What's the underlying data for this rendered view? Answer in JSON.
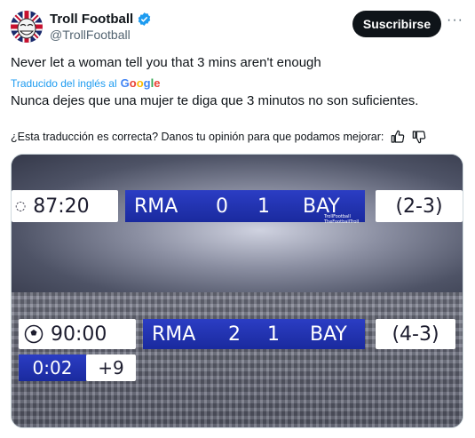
{
  "header": {
    "display_name": "Troll Football",
    "handle": "@TrollFootball",
    "subscribe_label": "Suscribirse",
    "more_label": "···"
  },
  "tweet": {
    "text": "Never let a woman tell you that 3 mins aren't enough",
    "translated_from": "Traducido del inglés al",
    "google_label": "Google",
    "translation": "Nunca dejes que una mujer te diga que 3 minutos no son suficientes.",
    "feedback": "¿Esta traducción es correcta? Danos tu opinión para que podamos mejorar:"
  },
  "media": {
    "top": {
      "time": "87:20",
      "home": "RMA",
      "home_score": "0",
      "away_score": "1",
      "away": "BAY",
      "aggregate": "(2-3)",
      "logo1": "TrollFootball",
      "logo2": "TheFootballTroll"
    },
    "bottom": {
      "time": "90:00",
      "home": "RMA",
      "home_score": "2",
      "away_score": "1",
      "away": "BAY",
      "aggregate": "(4-3)",
      "stoppage_time": "0:02",
      "added_time": "+9"
    }
  },
  "colors": {
    "verified_badge": "#1d9bf0",
    "link": "#1d9bf0",
    "scoreboard_blue": "#2233b8"
  },
  "icons": [
    "verified-badge-icon",
    "more-icon",
    "thumbs-up-icon",
    "thumbs-down-icon",
    "champions-league-ball-icon"
  ]
}
